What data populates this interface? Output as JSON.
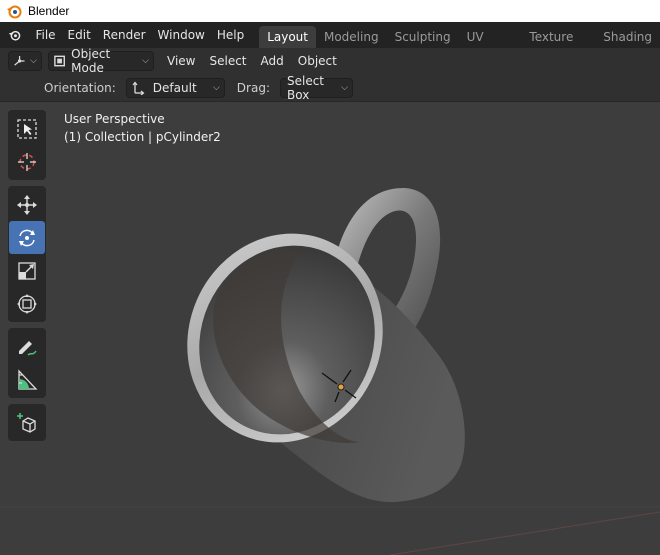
{
  "window": {
    "title": "Blender"
  },
  "menu": {
    "file": "File",
    "edit": "Edit",
    "render": "Render",
    "window": "Window",
    "help": "Help"
  },
  "workspaces": [
    {
      "label": "Layout",
      "active": true
    },
    {
      "label": "Modeling",
      "active": false
    },
    {
      "label": "Sculpting",
      "active": false
    },
    {
      "label": "UV Editing",
      "active": false
    },
    {
      "label": "Texture Paint",
      "active": false
    },
    {
      "label": "Shading",
      "active": false
    }
  ],
  "header": {
    "mode": "Object Mode",
    "view": "View",
    "select": "Select",
    "add": "Add",
    "object": "Object"
  },
  "tool_settings": {
    "orientation_label": "Orientation:",
    "orientation_value": "Default",
    "drag_label": "Drag:",
    "drag_value": "Select Box"
  },
  "viewport": {
    "perspective": "User Perspective",
    "collection": "(1) Collection | pCylinder2"
  },
  "toolbar": {
    "tools": [
      "select-box",
      "cursor",
      "move",
      "rotate",
      "scale",
      "transform",
      "annotate",
      "measure",
      "add-cube"
    ],
    "active_tool": "rotate"
  },
  "colors": {
    "active_tab_bg": "#3d3d3d",
    "accent": "#4772b3",
    "viewport_bg": "#3d3d3d"
  }
}
